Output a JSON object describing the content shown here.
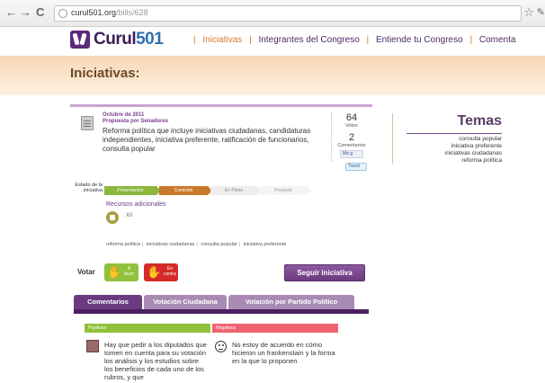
{
  "browser": {
    "url_host": "curul501.org",
    "url_path": "/bills/628",
    "back_icon": "←",
    "forward_icon": "→",
    "reload_icon": "C",
    "star_icon": "☆",
    "wrench_icon": "✎"
  },
  "site": {
    "logo_text": "Curul",
    "logo_number": "501",
    "nav": [
      {
        "label": "Iniciativas",
        "active": true
      },
      {
        "label": "Integrantes del Congreso",
        "active": false
      },
      {
        "label": "Entiende tu Congreso",
        "active": false
      },
      {
        "label": "Comenta",
        "active": false
      }
    ]
  },
  "page": {
    "title": "Iniciativas:"
  },
  "bill": {
    "date": "Octubre de 2011",
    "proposer": "Propuesta por Senadores",
    "description": "Reforma política que incluye iniciativas ciudadanas, candidaturas independientes, iniciativa preferente, ratificación de funcionarios, consulta popular",
    "votes_count": "64",
    "votes_label": "Votos",
    "comments_count": "2",
    "comments_label": "Comentarios",
    "like_label": "Me g",
    "tweet_label": "Tweet",
    "status_label": "Estado de la iniciativa",
    "steps": [
      "Presentación",
      "Comisión",
      "En Pleno",
      "Proyecto"
    ],
    "resources_title": "Recursos adicionales",
    "resource_label": "XII",
    "tags": [
      "reforma política",
      "iniciativas ciudadanas",
      "consulta popular",
      "iniciativa preferente"
    ]
  },
  "temas": {
    "title": "Temas",
    "items": [
      "consulta popular",
      "iniciativa preferente",
      "iniciativas ciudadanas",
      "reforma política"
    ]
  },
  "vote": {
    "label": "Votar",
    "favor_line1": "A",
    "favor_line2": "favor",
    "contra_line1": "En",
    "contra_line2": "contra",
    "follow_button": "Seguir iniciativa"
  },
  "tabs": [
    "Comentarios",
    "Votación Ciudadana",
    "Votación por Partido Político"
  ],
  "comments": {
    "positive_header": "Positivos",
    "negative_header": "Negativos",
    "positive_text": "Hay que pedir a los diputados que tomen en cuenta para su votación los análisis y los estudios sobre los beneficios de cada uno de los rubros, y que",
    "negative_text": "No estoy de acuerdo en cómo hicieron un frankenstain y la forma en la que lo proponen"
  }
}
